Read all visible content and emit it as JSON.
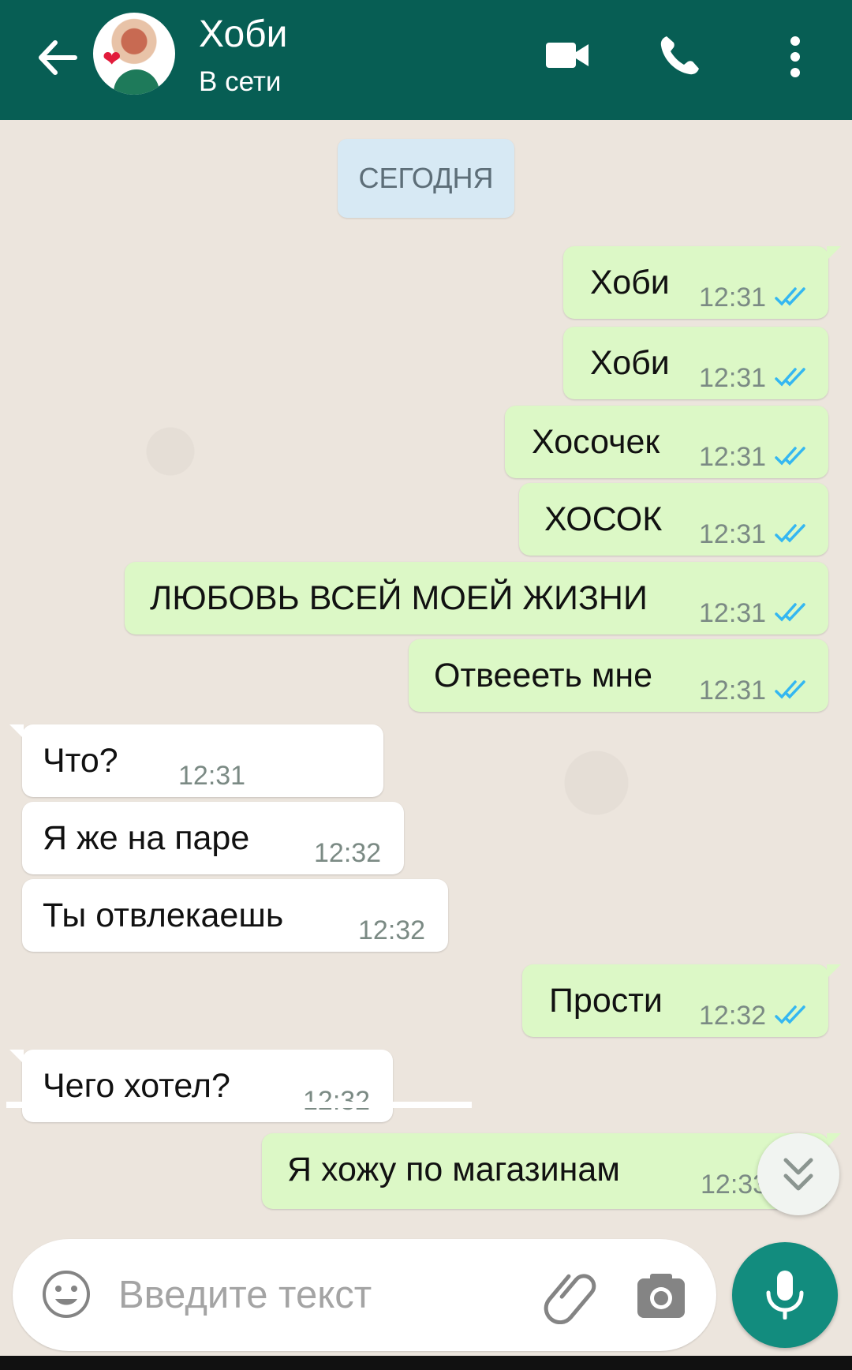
{
  "header": {
    "contact_name": "Хоби",
    "status": "В сети"
  },
  "chat": {
    "date_chip": "СЕГОДНЯ",
    "messages": [
      {
        "text": "Хоби",
        "time": "12:31",
        "direction": "outgoing",
        "status": "read"
      },
      {
        "text": "Хоби",
        "time": "12:31",
        "direction": "outgoing",
        "status": "read"
      },
      {
        "text": "Хосочек",
        "time": "12:31",
        "direction": "outgoing",
        "status": "read"
      },
      {
        "text": "ХОСОК",
        "time": "12:31",
        "direction": "outgoing",
        "status": "read"
      },
      {
        "text": "ЛЮБОВЬ ВСЕЙ МОЕЙ ЖИЗНИ",
        "time": "12:31",
        "direction": "outgoing",
        "status": "read"
      },
      {
        "text": "Отвеееть мне",
        "time": "12:31",
        "direction": "outgoing",
        "status": "read"
      },
      {
        "text": "Что?",
        "time": "12:31",
        "direction": "incoming"
      },
      {
        "text": "Я же на паре",
        "time": "12:32",
        "direction": "incoming"
      },
      {
        "text": "Ты отвлекаешь",
        "time": "12:32",
        "direction": "incoming"
      },
      {
        "text": "Прости",
        "time": "12:32",
        "direction": "outgoing",
        "status": "read"
      },
      {
        "text": "Чего хотел?",
        "time": "12:32",
        "direction": "incoming"
      },
      {
        "text": "Я хожу по магазинам",
        "time": "12:33",
        "direction": "outgoing",
        "status": "read"
      }
    ]
  },
  "composer": {
    "placeholder": "Введите текст"
  },
  "colors": {
    "header": "#075e54",
    "outgoing_bubble": "#dcf8c6",
    "incoming_bubble": "#ffffff",
    "read_ticks": "#34b7f1",
    "mic_button": "#128c7e"
  },
  "icons": {
    "back": "arrow-left-icon",
    "video": "video-call-icon",
    "phone": "phone-icon",
    "menu": "more-vertical-icon",
    "emoji": "emoji-icon",
    "attach": "paperclip-icon",
    "camera": "camera-icon",
    "mic": "microphone-icon",
    "scroll": "double-chevron-down-icon"
  }
}
